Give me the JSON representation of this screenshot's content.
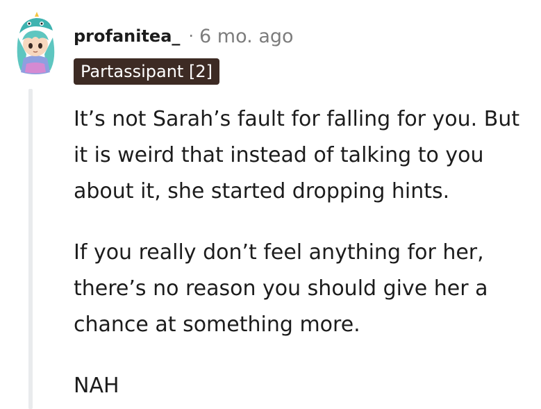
{
  "comment": {
    "username": "profanitea_",
    "separator": "·",
    "timestamp": "6 mo. ago",
    "flair": "Partassipant [2]",
    "avatar_icon": "user-avatar-icon",
    "paragraphs": [
      "It’s not Sarah’s fault for falling for you. But it is weird that instead of talking to you about it, she started dropping hints.",
      "If you really don’t feel anything for her, there’s no reason you should give her a chance at something more.",
      "NAH"
    ]
  }
}
